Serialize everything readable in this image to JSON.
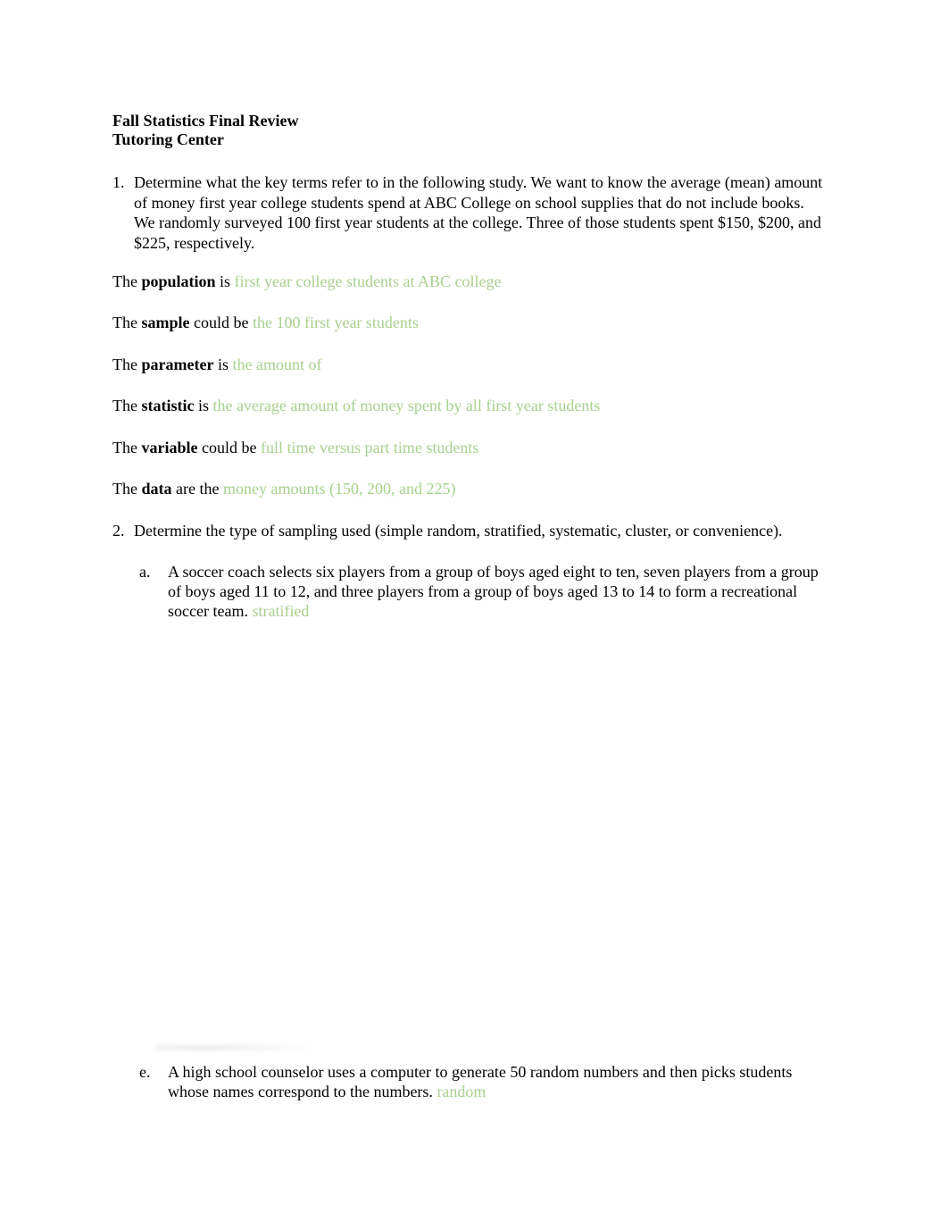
{
  "header": {
    "title": "Fall Statistics Final Review",
    "subtitle": "Tutoring Center"
  },
  "question1": {
    "number": "1.",
    "text": "Determine what the key terms refer to in the following study. We want to know the average (mean) amount of money first year college students spend at ABC College on school supplies that do not include books. We randomly surveyed 100 first year students at the college. Three of those students spent $150, $200, and $225, respectively.",
    "terms": [
      {
        "prefix": "The ",
        "term": "population",
        "connector": " is ",
        "answer": "first year college students at ABC college"
      },
      {
        "prefix": "The ",
        "term": "sample",
        "connector": " could be ",
        "answer": "the 100 first year students"
      },
      {
        "prefix": "The ",
        "term": "parameter",
        "connector": " is ",
        "answer": "the amount of"
      },
      {
        "prefix": "The ",
        "term": "statistic",
        "connector": " is ",
        "answer": "the average amount of money spent by all first year students"
      },
      {
        "prefix": "The ",
        "term": "variable",
        "connector": " could be ",
        "answer": "full time versus part time students"
      },
      {
        "prefix": "The ",
        "term": "data",
        "connector": " are the ",
        "answer": "money amounts (150, 200, and 225)"
      }
    ]
  },
  "question2": {
    "number": "2.",
    "text": "Determine the type of sampling used (simple random, stratified, systematic, cluster, or convenience).",
    "parts": [
      {
        "letter": "a.",
        "text": "A soccer coach selects six players from a group of boys aged eight to ten, seven players from a group of boys aged 11 to 12, and three players from a group of boys aged 13 to 14 to form a recreational soccer team.",
        "answer": "stratified"
      },
      {
        "letter": "e.",
        "text": "A high school counselor uses a computer to generate 50 random numbers and then picks students whose names correspond to the numbers.",
        "answer": "random"
      }
    ]
  },
  "colors": {
    "answer": "#a8d08d",
    "text": "#000000",
    "background": "#ffffff"
  }
}
